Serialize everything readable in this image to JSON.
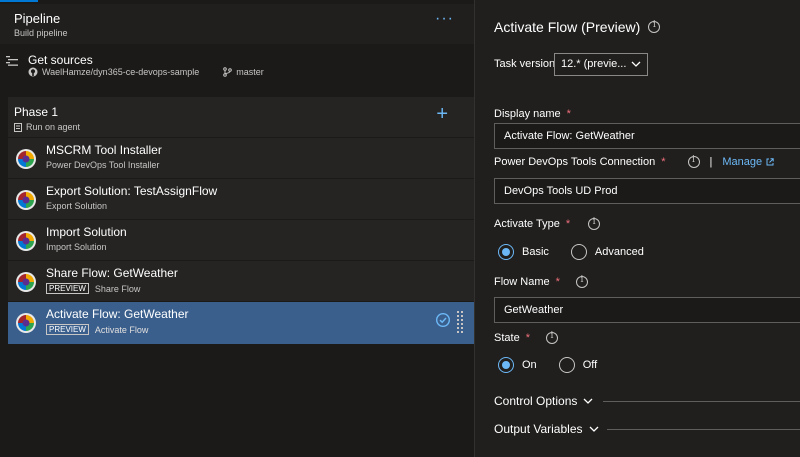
{
  "pipeline": {
    "title": "Pipeline",
    "subtitle": "Build pipeline",
    "more_label": "···"
  },
  "sources": {
    "title": "Get sources",
    "repo": "WaelHamze/dyn365-ce-devops-sample",
    "branch": "master"
  },
  "phase": {
    "title": "Phase 1",
    "subtitle": "Run on agent",
    "add_label": "+"
  },
  "tasks": [
    {
      "name": "MSCRM Tool Installer",
      "sub": "Power DevOps Tool Installer",
      "preview": ""
    },
    {
      "name": "Export Solution: TestAssignFlow",
      "sub": "Export Solution",
      "preview": ""
    },
    {
      "name": "Import Solution",
      "sub": "Import Solution",
      "preview": ""
    },
    {
      "name": "Share Flow: GetWeather",
      "sub": "Share Flow",
      "preview": "PREVIEW"
    },
    {
      "name": "Activate Flow: GetWeather",
      "sub": "Activate Flow",
      "preview": "PREVIEW"
    }
  ],
  "selected_task_index": 4,
  "details": {
    "title": "Activate Flow (Preview)",
    "task_version_label": "Task version",
    "task_version_value": "12.* (previe...",
    "display_name_label": "Display name",
    "display_name_value": "Activate Flow: GetWeather",
    "connection_label": "Power DevOps Tools Connection",
    "manage_label": "Manage",
    "separator": "|",
    "connection_value": "DevOps Tools UD Prod",
    "activate_type_label": "Activate Type",
    "activate_type_options": [
      "Basic",
      "Advanced"
    ],
    "activate_type_selected": "Basic",
    "flow_name_label": "Flow Name",
    "flow_name_value": "GetWeather",
    "state_label": "State",
    "state_options": [
      "On",
      "Off"
    ],
    "state_selected": "On",
    "required_mark": "*",
    "control_options_label": "Control Options",
    "output_variables_label": "Output Variables"
  },
  "colors": {
    "accent": "#6cb8f6",
    "selected_row": "#3a5f8d",
    "required": "#f1707b",
    "brand_bar": "#0078d4"
  }
}
